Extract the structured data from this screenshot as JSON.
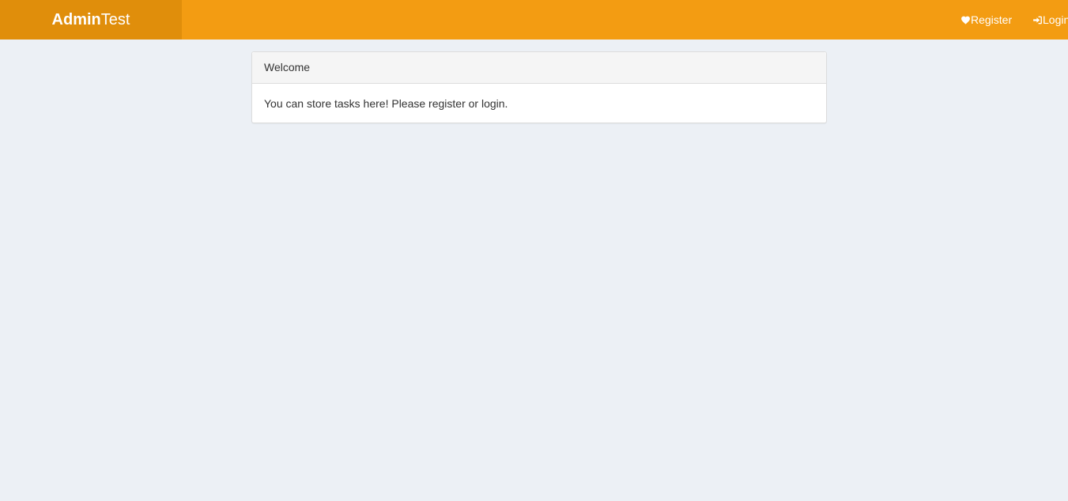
{
  "header": {
    "logo_bold": "Admin",
    "logo_light": "Test",
    "nav": {
      "register_label": "Register",
      "register_icon": "heart-icon",
      "login_label": "Login",
      "login_icon": "sign-in-icon"
    },
    "colors": {
      "navbar": "#f39c12",
      "logo_background": "#e08e0b",
      "text": "#ffffff"
    }
  },
  "main": {
    "background": "#ecf0f5",
    "panel": {
      "heading": "Welcome",
      "body": "You can store tasks here! Please register or login."
    }
  }
}
